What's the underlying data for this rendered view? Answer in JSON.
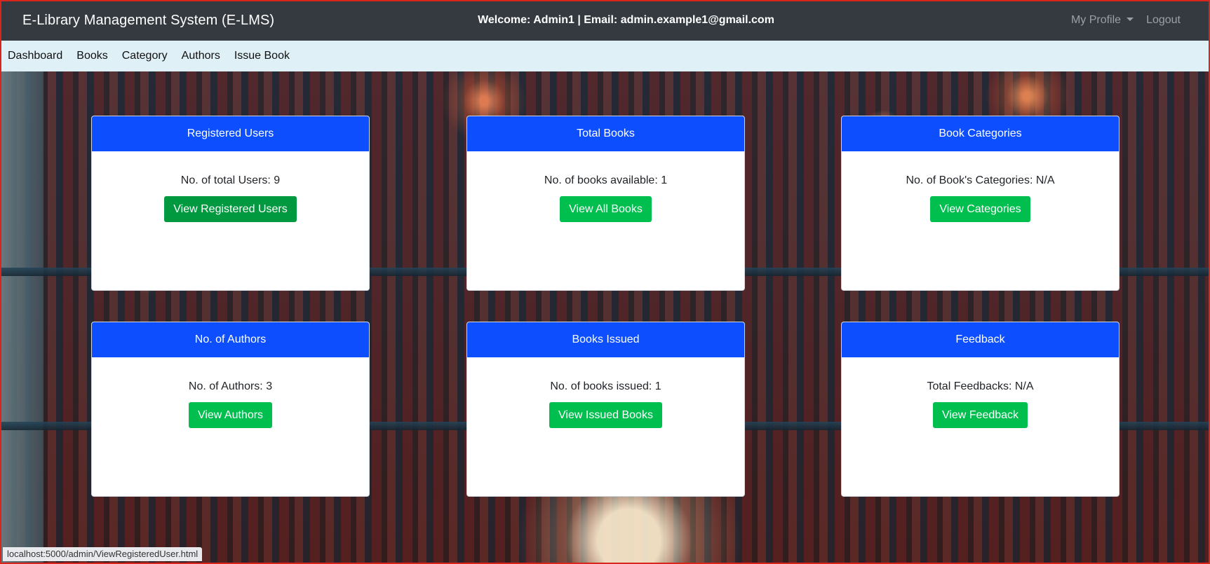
{
  "topbar": {
    "brand": "E-Library Management System (E-LMS)",
    "welcome": "Welcome: Admin1 | Email: admin.example1@gmail.com",
    "my_profile": "My Profile",
    "logout": "Logout"
  },
  "subnav": {
    "items": [
      "Dashboard",
      "Books",
      "Category",
      "Authors",
      "Issue Book"
    ]
  },
  "cards": [
    {
      "title": "Registered Users",
      "text": "No. of total Users: 9",
      "button": "View Registered Users"
    },
    {
      "title": "Total Books",
      "text": "No. of books available: 1",
      "button": "View All Books"
    },
    {
      "title": "Book Categories",
      "text": "No. of Book's Categories: N/A",
      "button": "View Categories"
    },
    {
      "title": "No. of Authors",
      "text": "No. of Authors: 3",
      "button": "View Authors"
    },
    {
      "title": "Books Issued",
      "text": "No. of books issued: 1",
      "button": "View Issued Books"
    },
    {
      "title": "Feedback",
      "text": "Total Feedbacks: N/A",
      "button": "View Feedback"
    }
  ],
  "status_url": "localhost:5000/admin/ViewRegisteredUser.html",
  "colors": {
    "navbar": "#343a40",
    "subnav": "#dff0f7",
    "card_header": "#0d4fff",
    "button": "#00bf4f",
    "frame_border": "#d9261c"
  }
}
